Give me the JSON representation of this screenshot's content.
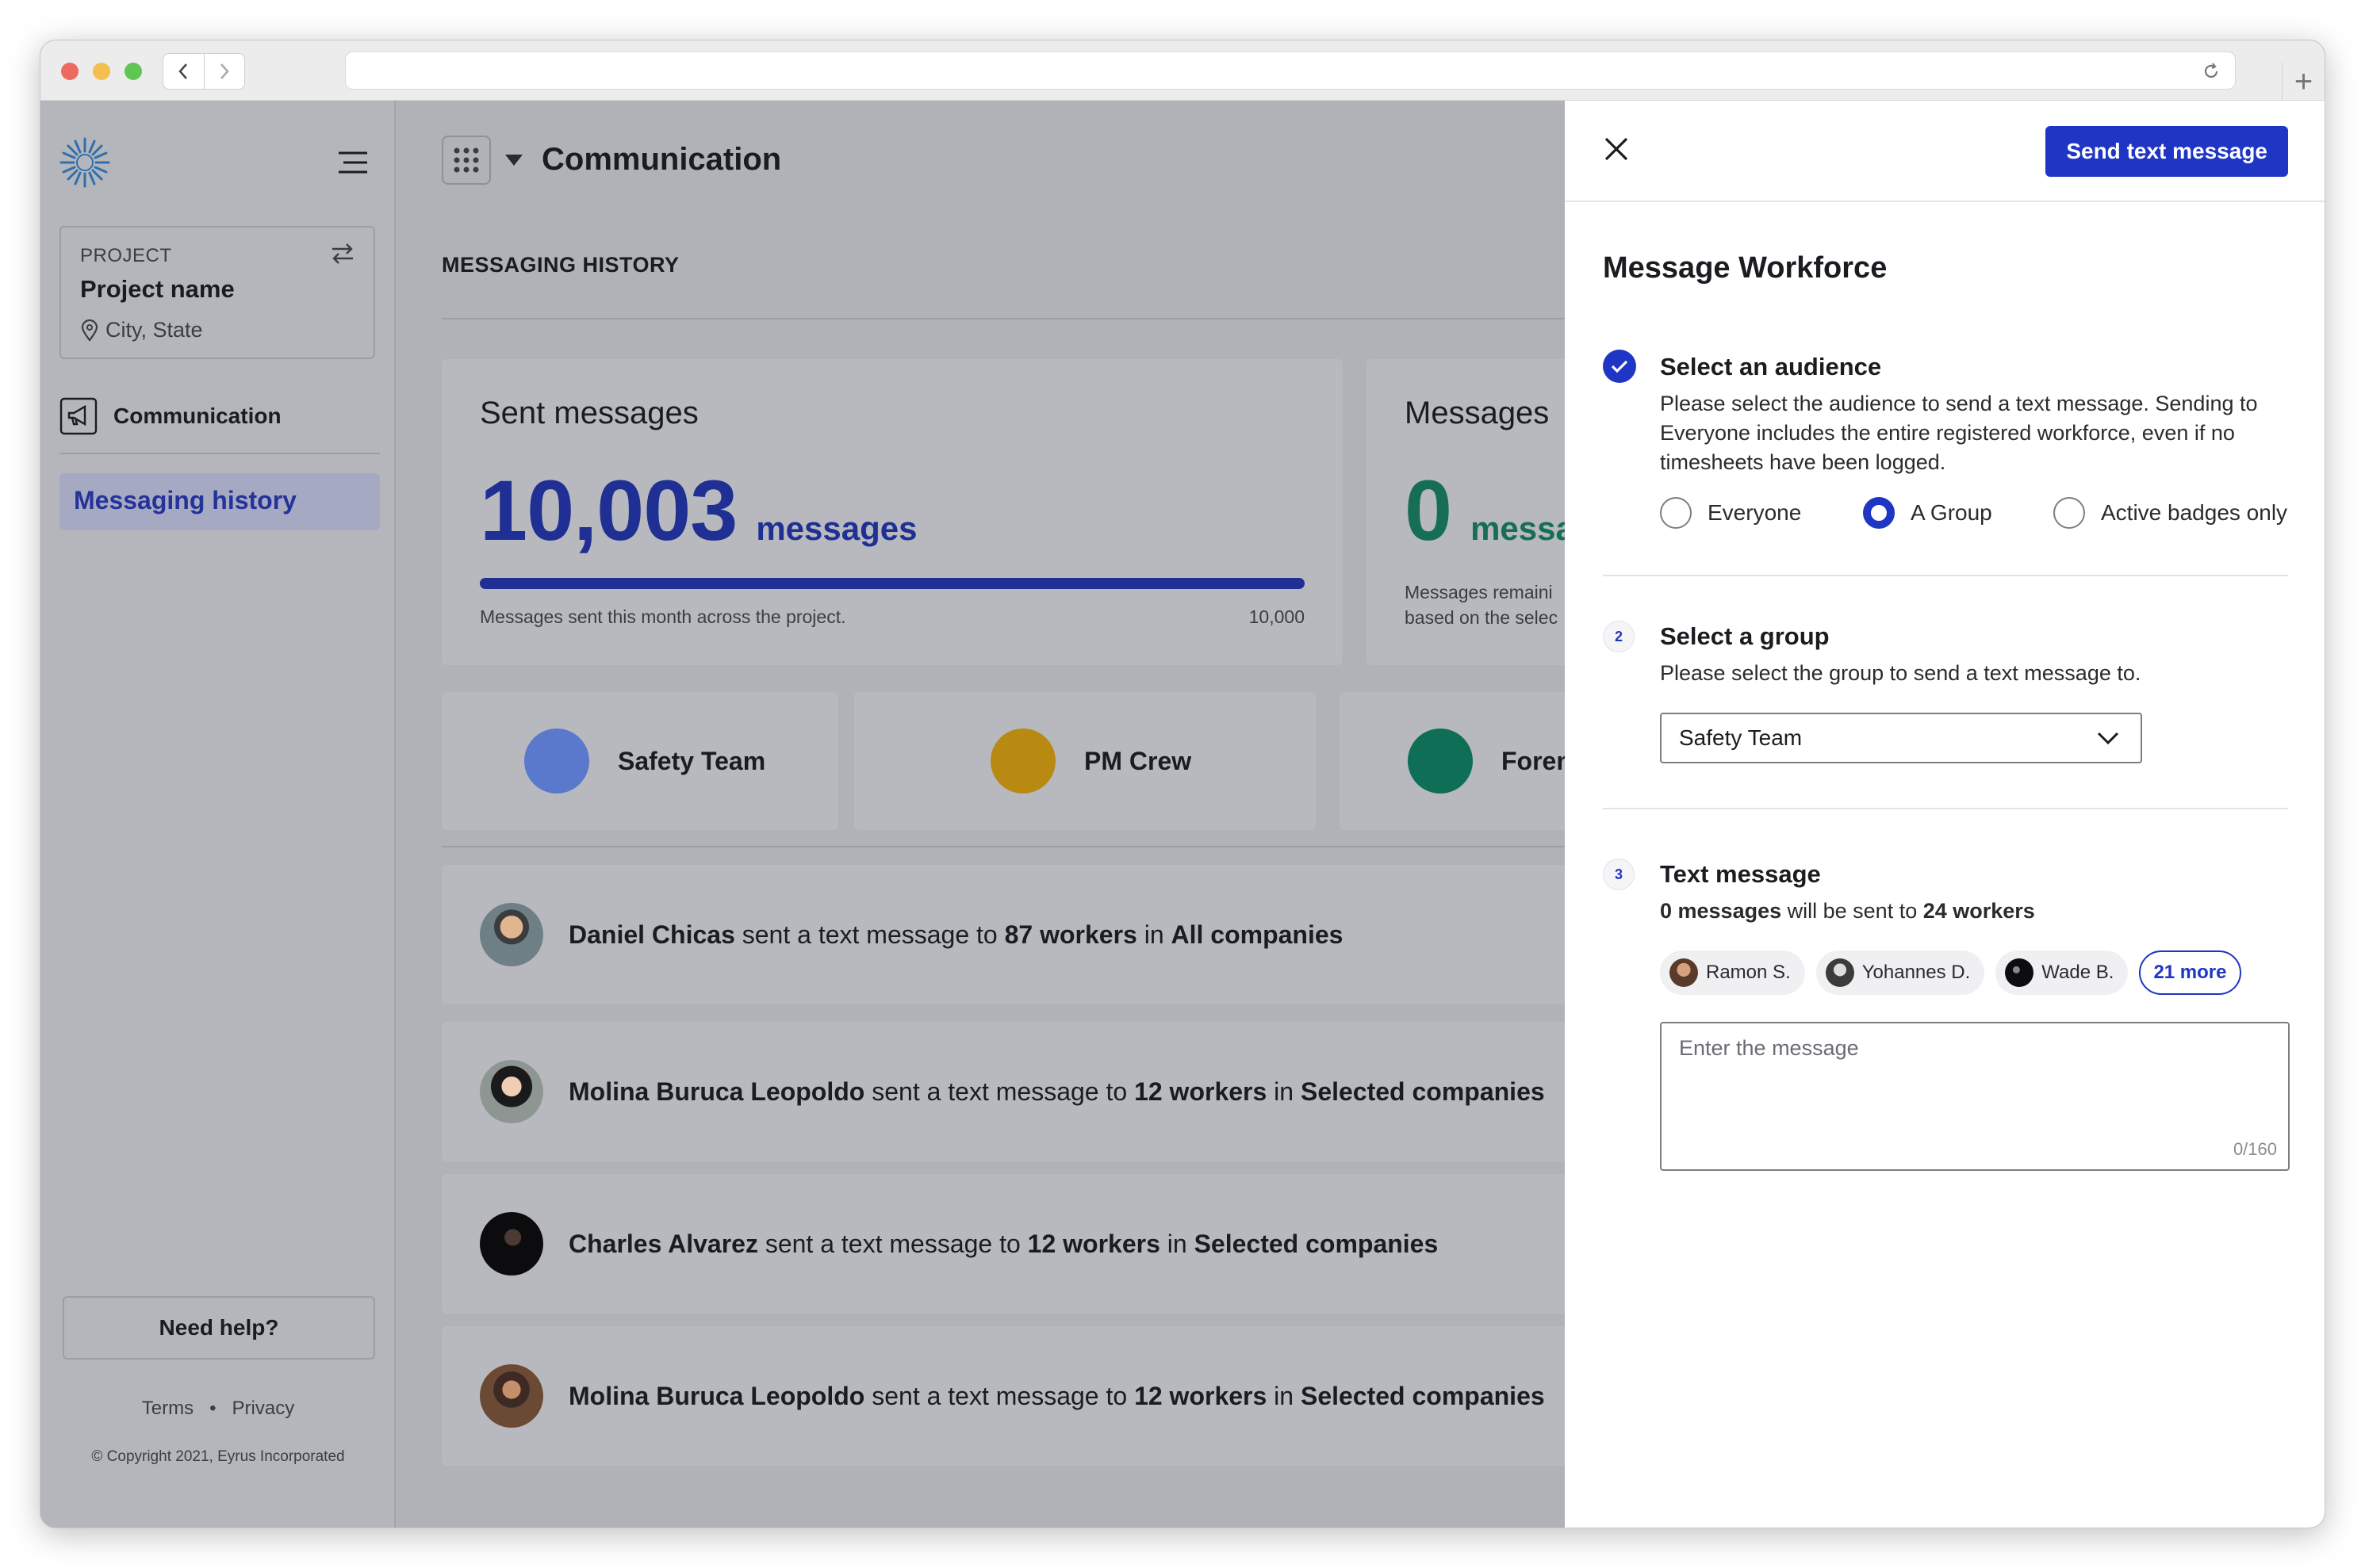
{
  "browser": {
    "new_tab": "+"
  },
  "sidebar": {
    "project_label": "PROJECT",
    "project_name": "Project name",
    "project_location": "City, State",
    "nav_communication": "Communication",
    "nav_messaging_history": "Messaging history",
    "help_button": "Need help?",
    "terms": "Terms",
    "separator": "•",
    "privacy": "Privacy",
    "copyright": "© Copyright 2021, Eyrus Incorporated"
  },
  "main": {
    "page_title": "Communication",
    "section_title": "MESSAGING HISTORY",
    "stats": [
      {
        "title": "Sent messages",
        "value": "10,003",
        "unit": "messages",
        "footnote": "Messages sent this month across the project.",
        "limit": "10,000",
        "progress": 1.0
      },
      {
        "title": "Messages",
        "value": "0",
        "unit": "messa",
        "footnote_line1": "Messages remaini",
        "footnote_line2": "based on the selec"
      }
    ],
    "groups": [
      {
        "name": "Safety Team",
        "color": "#5a79cc"
      },
      {
        "name": "PM Crew",
        "color": "#b98a12"
      },
      {
        "name": "Forem",
        "color": "#0f6e56"
      }
    ],
    "messages": [
      {
        "sender": "Daniel Chicas",
        "verb": " sent a text message to ",
        "count": "87 workers",
        "prep": " in ",
        "target": "All companies"
      },
      {
        "sender": "Molina Buruca Leopoldo",
        "verb": " sent a text message to ",
        "count": "12 workers",
        "prep": " in ",
        "target": "Selected companies"
      },
      {
        "sender": "Charles Alvarez",
        "verb": " sent a text message to ",
        "count": "12 workers",
        "prep": " in ",
        "target": "Selected companies"
      },
      {
        "sender": "Molina Buruca Leopoldo",
        "verb": " sent a text message to ",
        "count": "12 workers",
        "prep": " in ",
        "target": "Selected companies"
      }
    ]
  },
  "panel": {
    "send_button": "Send text message",
    "title": "Message Workforce",
    "step1": {
      "title": "Select an audience",
      "desc": "Please select the audience to send a text message. Sending to Everyone includes the entire registered workforce, even if no timesheets have been logged.",
      "options": [
        "Everyone",
        "A Group",
        "Active badges only"
      ],
      "selected": "A Group"
    },
    "step2": {
      "number": "2",
      "title": "Select a group",
      "desc": "Please select the group to send a text message to.",
      "selected_group": "Safety Team"
    },
    "step3": {
      "number": "3",
      "title": "Text message",
      "count_bold": "0 messages",
      "count_mid": " will be sent to ",
      "workers_bold": "24 workers",
      "recipients": [
        "Ramon S.",
        "Yohannes D.",
        "Wade B."
      ],
      "more": "21 more",
      "placeholder": "Enter the message",
      "counter": "0/160"
    }
  }
}
